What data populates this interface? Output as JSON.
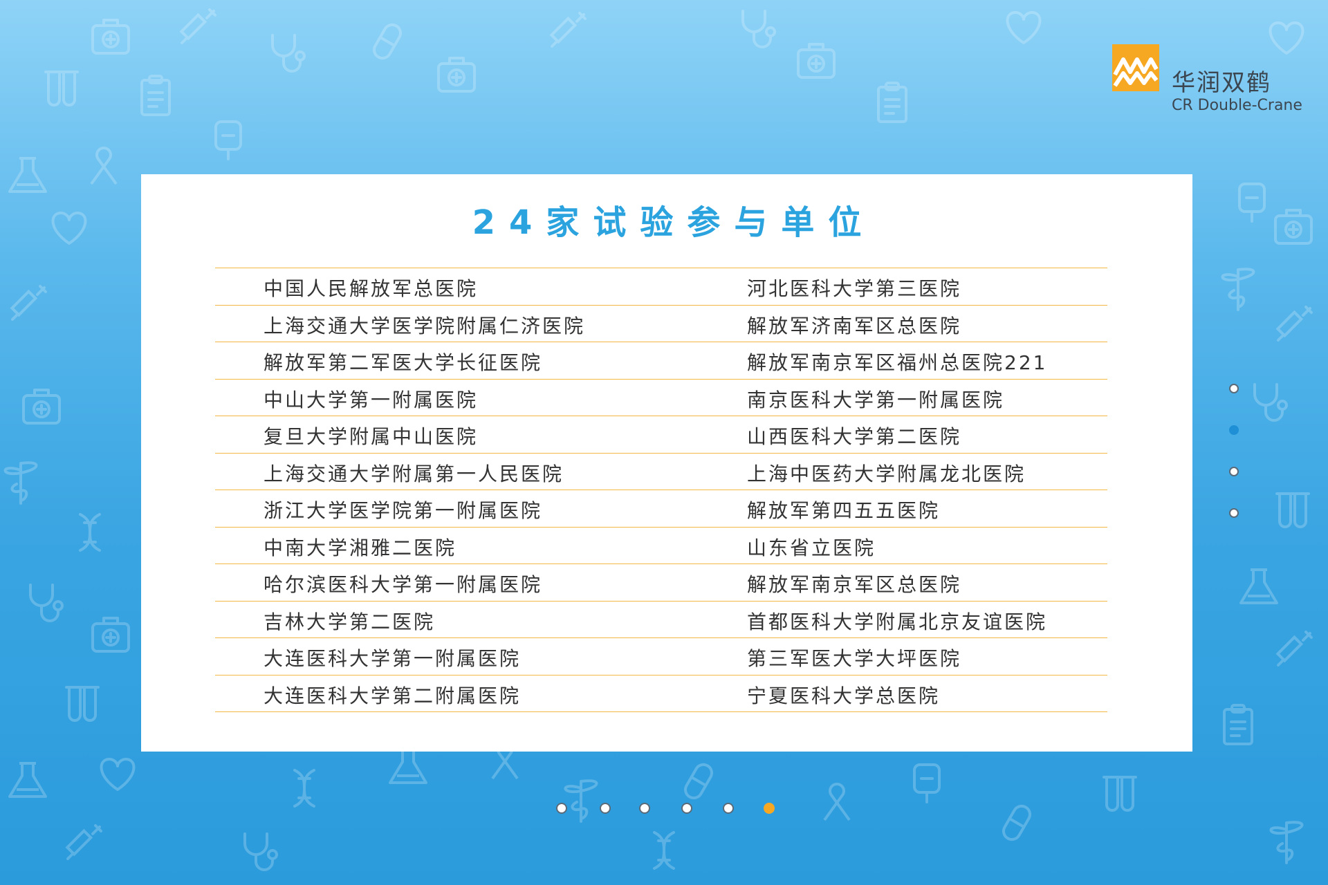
{
  "brand": {
    "name_cn": "华润双鹤",
    "name_en": "CR Double-Crane",
    "colors": {
      "accent": "#f7a823",
      "title": "#2aa3de",
      "rule": "#f3b743",
      "nav_active": "#1f8fd6"
    }
  },
  "card": {
    "title": "24家试验参与单位",
    "rows": [
      {
        "left": "中国人民解放军总医院",
        "right": "河北医科大学第三医院"
      },
      {
        "left": "上海交通大学医学院附属仁济医院",
        "right": "解放军济南军区总医院"
      },
      {
        "left": "解放军第二军医大学长征医院",
        "right": "解放军南京军区福州总医院221"
      },
      {
        "left": "中山大学第一附属医院",
        "right": "南京医科大学第一附属医院"
      },
      {
        "left": "复旦大学附属中山医院",
        "right": "山西医科大学第二医院"
      },
      {
        "left": "上海交通大学附属第一人民医院",
        "right": "上海中医药大学附属龙北医院"
      },
      {
        "left": "浙江大学医学院第一附属医院",
        "right": "解放军第四五五医院"
      },
      {
        "left": "中南大学湘雅二医院",
        "right": "山东省立医院"
      },
      {
        "left": "哈尔滨医科大学第一附属医院",
        "right": "解放军南京军区总医院"
      },
      {
        "left": "吉林大学第二医院",
        "right": "首都医科大学附属北京友谊医院"
      },
      {
        "left": "大连医科大学第一附属医院",
        "right": "第三军医大学大坪医院"
      },
      {
        "left": "大连医科大学第二附属医院",
        "right": "宁夏医科大学总医院"
      }
    ]
  },
  "side_nav": {
    "active_index": 1,
    "count": 4
  },
  "pager": {
    "active_index": 5,
    "count": 6
  },
  "icons": [
    "first-aid-kit-icon",
    "heart-icon",
    "stethoscope-icon",
    "syringe-icon",
    "test-tube-icon",
    "flask-icon",
    "pill-icon",
    "clipboard-icon",
    "ribbon-icon",
    "caduceus-icon",
    "iv-bag-icon",
    "dna-icon",
    "thermometer-icon"
  ]
}
